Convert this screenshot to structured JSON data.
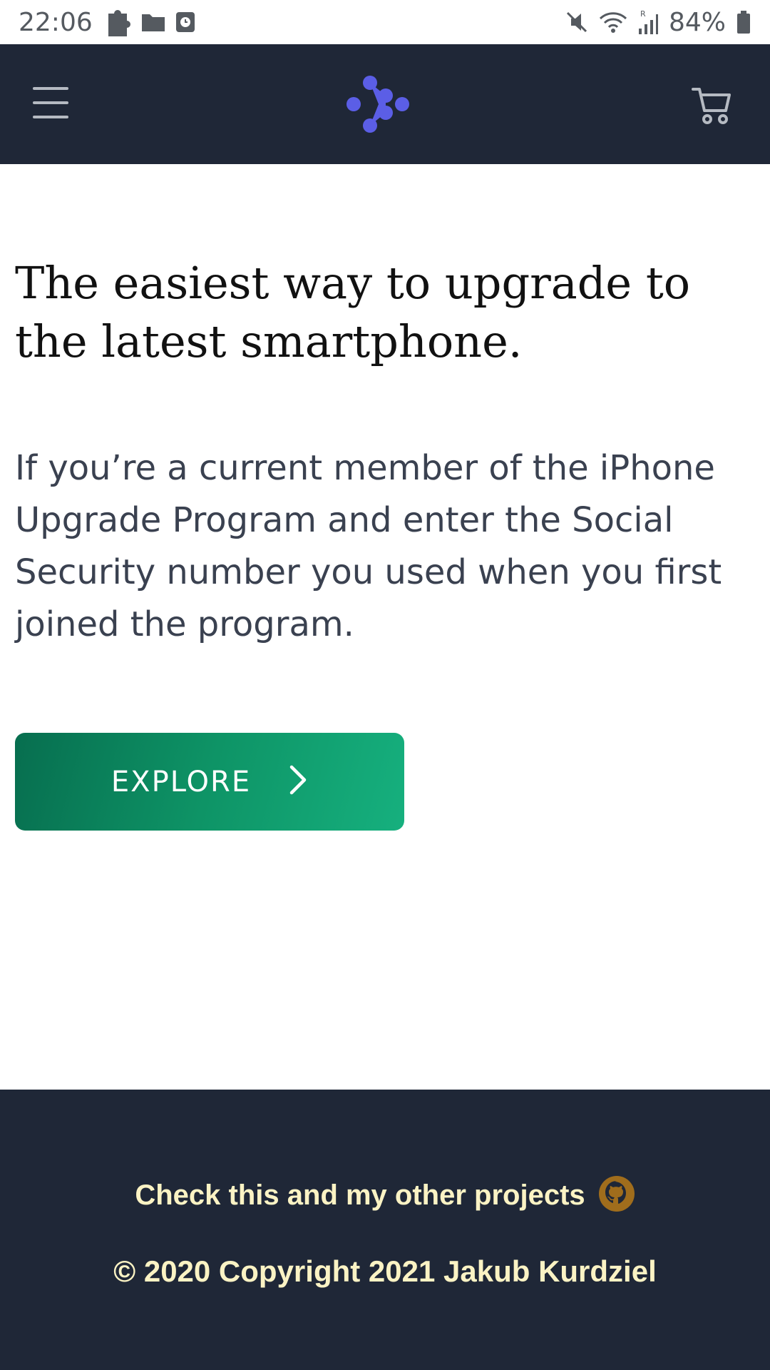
{
  "status_bar": {
    "time": "22:06",
    "battery": "84%",
    "left_icons": [
      "puzzle-icon",
      "folder-icon",
      "clock-card-icon"
    ],
    "right_icons": [
      "mute-icon",
      "wifi-icon",
      "signal-icon",
      "battery-icon"
    ]
  },
  "header": {
    "menu_icon": "hamburger-menu-icon",
    "logo_icon": "dots-logo-icon",
    "cart_icon": "shopping-cart-icon",
    "logo_color": "#5b5ee6",
    "background": "#1f2737"
  },
  "main": {
    "headline": "The easiest way to upgrade to the latest smartphone.",
    "description": "If you’re a current member of the iPhone Upgrade Program and enter the Social Security number you used when you first joined the program.",
    "explore_button": {
      "label": "EXPLORE",
      "icon": "chevron-right-icon",
      "color": "#0e9466"
    }
  },
  "footer": {
    "projects_link": "Check this and my other projects",
    "projects_icon": "github-icon",
    "copyright": "© 2020 Copyright 2021 Jakub Kurdziel",
    "text_color": "#fbf3c4",
    "icon_color": "#a06d1c"
  }
}
